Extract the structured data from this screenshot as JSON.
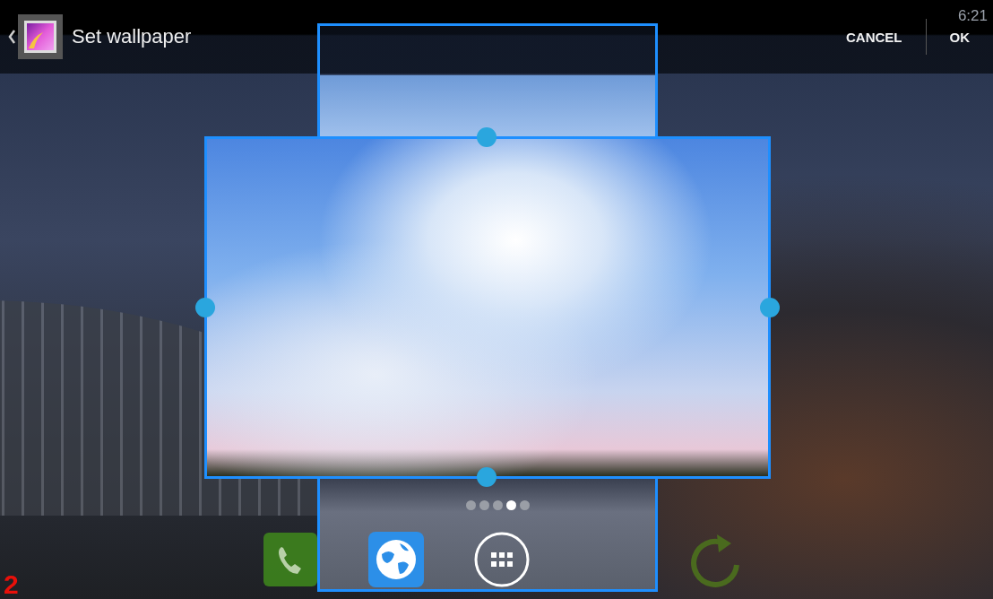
{
  "status_bar": {
    "time": "6:21"
  },
  "action_bar": {
    "title": "Set wallpaper",
    "buttons": [
      {
        "label": "CANCEL"
      },
      {
        "label": "OK"
      }
    ]
  },
  "page_indicator": [
    {
      "selected": false
    },
    {
      "selected": false
    },
    {
      "selected": false
    },
    {
      "selected": true
    },
    {
      "selected": false
    }
  ],
  "dock": [
    {
      "kind": "phone"
    },
    {
      "kind": "browser"
    },
    {
      "kind": "apps"
    },
    {
      "kind": "refresh"
    }
  ],
  "figure_label": "2"
}
